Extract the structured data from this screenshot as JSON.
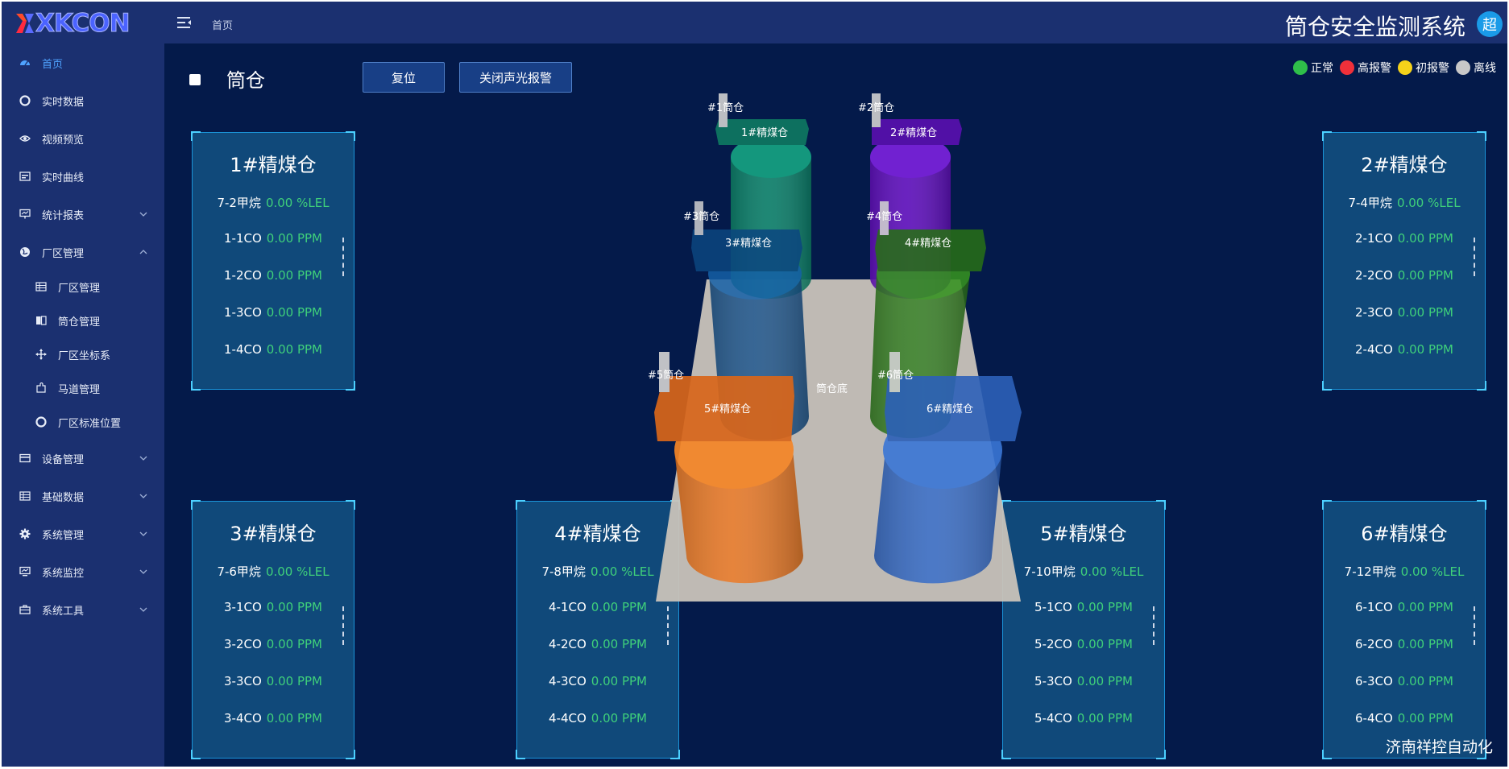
{
  "brand": {
    "logo_text": "XKCON"
  },
  "sidebar": {
    "items": [
      {
        "label": "首页",
        "icon": "dashboard-icon",
        "active": true
      },
      {
        "label": "实时数据",
        "icon": "life-ring-icon"
      },
      {
        "label": "视频预览",
        "icon": "eye-icon"
      },
      {
        "label": "实时曲线",
        "icon": "chart-icon"
      },
      {
        "label": "统计报表",
        "icon": "report-icon",
        "expandable": true
      },
      {
        "label": "厂区管理",
        "icon": "globe-icon",
        "expandable": true,
        "expanded": true
      },
      {
        "label": "厂区管理",
        "icon": "table-icon",
        "sub": true
      },
      {
        "label": "筒仓管理",
        "icon": "book-icon",
        "sub": true
      },
      {
        "label": "厂区坐标系",
        "icon": "move-icon",
        "sub": true
      },
      {
        "label": "马道管理",
        "icon": "puzzle-icon",
        "sub": true
      },
      {
        "label": "厂区标准位置",
        "icon": "life-ring-icon",
        "sub": true
      },
      {
        "label": "设备管理",
        "icon": "card-icon",
        "expandable": true
      },
      {
        "label": "基础数据",
        "icon": "table-icon",
        "expandable": true
      },
      {
        "label": "系统管理",
        "icon": "gear-icon",
        "expandable": true
      },
      {
        "label": "系统监控",
        "icon": "monitor-icon",
        "expandable": true
      },
      {
        "label": "系统工具",
        "icon": "toolbox-icon",
        "expandable": true
      }
    ]
  },
  "topbar": {
    "breadcrumb": "首页",
    "system_title": "筒仓安全监测系统",
    "avatar_text": "超"
  },
  "toolbar": {
    "page_title": "筒仓",
    "reset_label": "复位",
    "mute_alarm_label": "关闭声光报警"
  },
  "legend": [
    {
      "label": "正常",
      "color": "#2fbf4a"
    },
    {
      "label": "高报警",
      "color": "#f0303a"
    },
    {
      "label": "初报警",
      "color": "#f5d21a"
    },
    {
      "label": "离线",
      "color": "#c8c8c8"
    }
  ],
  "panels": [
    {
      "title": "1#精煤仓",
      "rows": [
        {
          "label": "7-2甲烷",
          "value": "0.00 %LEL"
        },
        {
          "label": "1-1CO",
          "value": "0.00 PPM"
        },
        {
          "label": "1-2CO",
          "value": "0.00 PPM"
        },
        {
          "label": "1-3CO",
          "value": "0.00 PPM"
        },
        {
          "label": "1-4CO",
          "value": "0.00 PPM"
        }
      ]
    },
    {
      "title": "2#精煤仓",
      "rows": [
        {
          "label": "7-4甲烷",
          "value": "0.00 %LEL"
        },
        {
          "label": "2-1CO",
          "value": "0.00 PPM"
        },
        {
          "label": "2-2CO",
          "value": "0.00 PPM"
        },
        {
          "label": "2-3CO",
          "value": "0.00 PPM"
        },
        {
          "label": "2-4CO",
          "value": "0.00 PPM"
        }
      ]
    },
    {
      "title": "3#精煤仓",
      "rows": [
        {
          "label": "7-6甲烷",
          "value": "0.00 %LEL"
        },
        {
          "label": "3-1CO",
          "value": "0.00 PPM"
        },
        {
          "label": "3-2CO",
          "value": "0.00 PPM"
        },
        {
          "label": "3-3CO",
          "value": "0.00 PPM"
        },
        {
          "label": "3-4CO",
          "value": "0.00 PPM"
        }
      ]
    },
    {
      "title": "4#精煤仓",
      "rows": [
        {
          "label": "7-8甲烷",
          "value": "0.00 %LEL"
        },
        {
          "label": "4-1CO",
          "value": "0.00 PPM"
        },
        {
          "label": "4-2CO",
          "value": "0.00 PPM"
        },
        {
          "label": "4-3CO",
          "value": "0.00 PPM"
        },
        {
          "label": "4-4CO",
          "value": "0.00 PPM"
        }
      ]
    },
    {
      "title": "5#精煤仓",
      "rows": [
        {
          "label": "7-10甲烷",
          "value": "0.00 %LEL"
        },
        {
          "label": "5-1CO",
          "value": "0.00 PPM"
        },
        {
          "label": "5-2CO",
          "value": "0.00 PPM"
        },
        {
          "label": "5-3CO",
          "value": "0.00 PPM"
        },
        {
          "label": "5-4CO",
          "value": "0.00 PPM"
        }
      ]
    },
    {
      "title": "6#精煤仓",
      "rows": [
        {
          "label": "7-12甲烷",
          "value": "0.00 %LEL"
        },
        {
          "label": "6-1CO",
          "value": "0.00 PPM"
        },
        {
          "label": "6-2CO",
          "value": "0.00 PPM"
        },
        {
          "label": "6-3CO",
          "value": "0.00 PPM"
        },
        {
          "label": "6-4CO",
          "value": "0.00 PPM"
        }
      ]
    }
  ],
  "scene": {
    "base_label": "筒仓底",
    "silos": [
      {
        "tag": "#1筒仓",
        "name": "1#精煤仓",
        "color": "#0f8a6e"
      },
      {
        "tag": "#2筒仓",
        "name": "2#精煤仓",
        "color": "#6a12c8"
      },
      {
        "tag": "#3筒仓",
        "name": "3#精煤仓",
        "color": "#0d4a86"
      },
      {
        "tag": "#4筒仓",
        "name": "4#精煤仓",
        "color": "#2c7a1a"
      },
      {
        "tag": "#5筒仓",
        "name": "5#精煤仓",
        "color": "#e87520"
      },
      {
        "tag": "#6筒仓",
        "name": "6#精煤仓",
        "color": "#2f66c4"
      }
    ]
  },
  "footer": {
    "company": "济南祥控自动化"
  }
}
